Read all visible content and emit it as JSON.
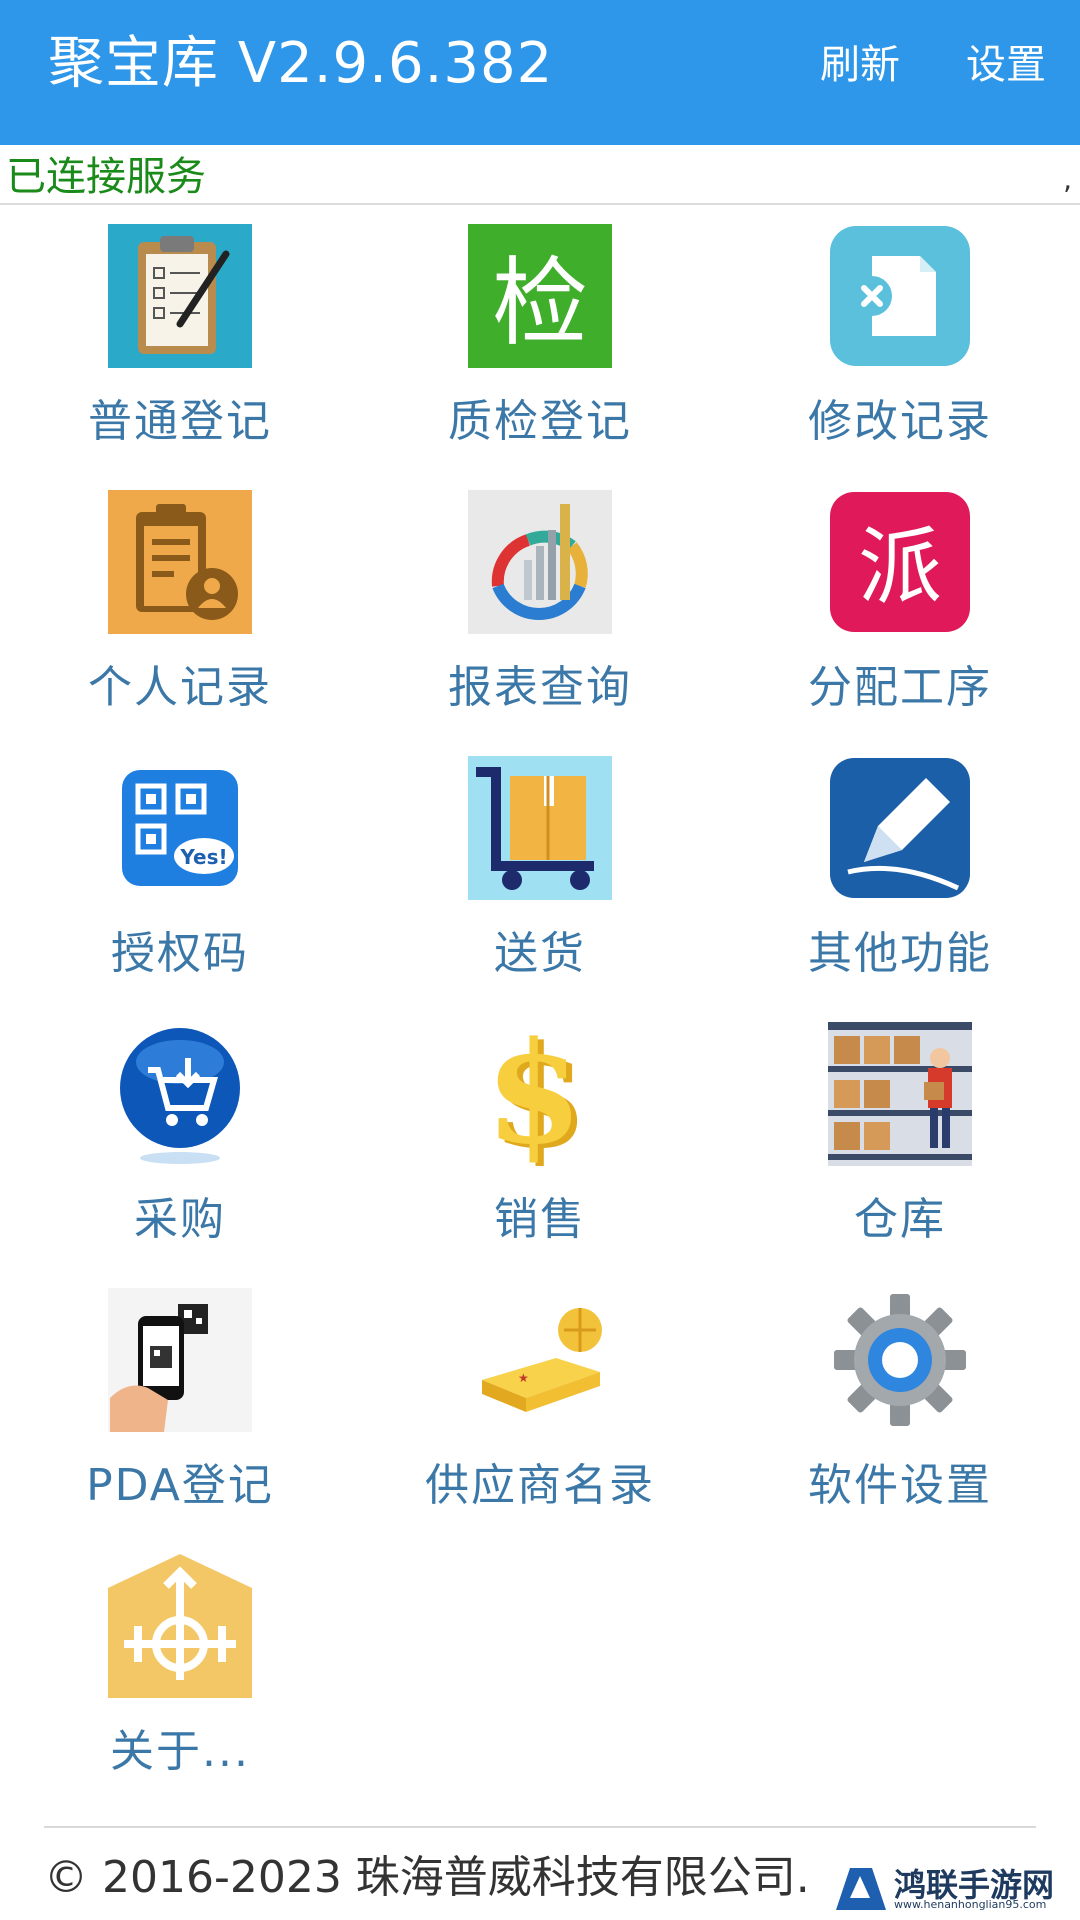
{
  "header": {
    "title": "聚宝库 V2.9.6.382",
    "refresh_label": "刷新",
    "settings_label": "设置",
    "bg_color": "#2e97ea"
  },
  "status": {
    "text": "已连接服务",
    "mark": ",",
    "color": "#1a8a1a"
  },
  "menu": [
    {
      "label": "普通登记",
      "icon": "clipboard-checklist-icon"
    },
    {
      "label": "质检登记",
      "icon": "inspection-icon"
    },
    {
      "label": "修改记录",
      "icon": "edit-document-icon"
    },
    {
      "label": "个人记录",
      "icon": "personal-record-icon"
    },
    {
      "label": "报表查询",
      "icon": "report-chart-icon"
    },
    {
      "label": "分配工序",
      "icon": "dispatch-icon"
    },
    {
      "label": "授权码",
      "icon": "qr-code-icon"
    },
    {
      "label": "送货",
      "icon": "delivery-cart-icon"
    },
    {
      "label": "其他功能",
      "icon": "pen-icon"
    },
    {
      "label": "采购",
      "icon": "shopping-cart-icon"
    },
    {
      "label": "销售",
      "icon": "dollar-icon"
    },
    {
      "label": "仓库",
      "icon": "warehouse-icon"
    },
    {
      "label": "PDA登记",
      "icon": "phone-scan-icon"
    },
    {
      "label": "供应商名录",
      "icon": "book-globe-icon"
    },
    {
      "label": "软件设置",
      "icon": "gear-icon"
    },
    {
      "label": "关于...",
      "icon": "about-icon"
    }
  ],
  "footer": {
    "copyright": "© 2016-2023 珠海普威科技有限公司."
  },
  "watermark": {
    "text": "鸿联手游网",
    "url": "www.henanhonglian95.com"
  }
}
